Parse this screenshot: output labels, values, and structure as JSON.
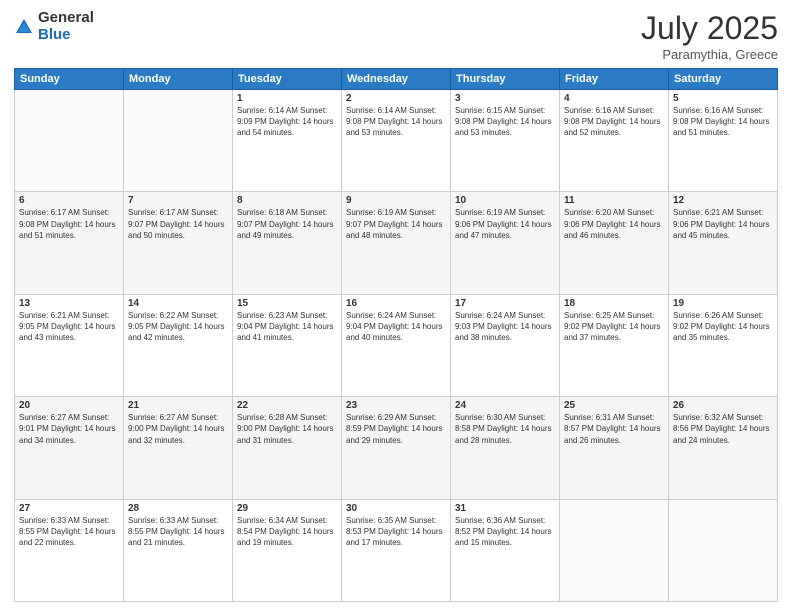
{
  "header": {
    "logo_general": "General",
    "logo_blue": "Blue",
    "title": "July 2025",
    "location": "Paramythia, Greece"
  },
  "weekdays": [
    "Sunday",
    "Monday",
    "Tuesday",
    "Wednesday",
    "Thursday",
    "Friday",
    "Saturday"
  ],
  "weeks": [
    [
      {
        "day": "",
        "info": ""
      },
      {
        "day": "",
        "info": ""
      },
      {
        "day": "1",
        "info": "Sunrise: 6:14 AM\nSunset: 9:09 PM\nDaylight: 14 hours and 54 minutes."
      },
      {
        "day": "2",
        "info": "Sunrise: 6:14 AM\nSunset: 9:08 PM\nDaylight: 14 hours and 53 minutes."
      },
      {
        "day": "3",
        "info": "Sunrise: 6:15 AM\nSunset: 9:08 PM\nDaylight: 14 hours and 53 minutes."
      },
      {
        "day": "4",
        "info": "Sunrise: 6:16 AM\nSunset: 9:08 PM\nDaylight: 14 hours and 52 minutes."
      },
      {
        "day": "5",
        "info": "Sunrise: 6:16 AM\nSunset: 9:08 PM\nDaylight: 14 hours and 51 minutes."
      }
    ],
    [
      {
        "day": "6",
        "info": "Sunrise: 6:17 AM\nSunset: 9:08 PM\nDaylight: 14 hours and 51 minutes."
      },
      {
        "day": "7",
        "info": "Sunrise: 6:17 AM\nSunset: 9:07 PM\nDaylight: 14 hours and 50 minutes."
      },
      {
        "day": "8",
        "info": "Sunrise: 6:18 AM\nSunset: 9:07 PM\nDaylight: 14 hours and 49 minutes."
      },
      {
        "day": "9",
        "info": "Sunrise: 6:19 AM\nSunset: 9:07 PM\nDaylight: 14 hours and 48 minutes."
      },
      {
        "day": "10",
        "info": "Sunrise: 6:19 AM\nSunset: 9:06 PM\nDaylight: 14 hours and 47 minutes."
      },
      {
        "day": "11",
        "info": "Sunrise: 6:20 AM\nSunset: 9:06 PM\nDaylight: 14 hours and 46 minutes."
      },
      {
        "day": "12",
        "info": "Sunrise: 6:21 AM\nSunset: 9:06 PM\nDaylight: 14 hours and 45 minutes."
      }
    ],
    [
      {
        "day": "13",
        "info": "Sunrise: 6:21 AM\nSunset: 9:05 PM\nDaylight: 14 hours and 43 minutes."
      },
      {
        "day": "14",
        "info": "Sunrise: 6:22 AM\nSunset: 9:05 PM\nDaylight: 14 hours and 42 minutes."
      },
      {
        "day": "15",
        "info": "Sunrise: 6:23 AM\nSunset: 9:04 PM\nDaylight: 14 hours and 41 minutes."
      },
      {
        "day": "16",
        "info": "Sunrise: 6:24 AM\nSunset: 9:04 PM\nDaylight: 14 hours and 40 minutes."
      },
      {
        "day": "17",
        "info": "Sunrise: 6:24 AM\nSunset: 9:03 PM\nDaylight: 14 hours and 38 minutes."
      },
      {
        "day": "18",
        "info": "Sunrise: 6:25 AM\nSunset: 9:02 PM\nDaylight: 14 hours and 37 minutes."
      },
      {
        "day": "19",
        "info": "Sunrise: 6:26 AM\nSunset: 9:02 PM\nDaylight: 14 hours and 35 minutes."
      }
    ],
    [
      {
        "day": "20",
        "info": "Sunrise: 6:27 AM\nSunset: 9:01 PM\nDaylight: 14 hours and 34 minutes."
      },
      {
        "day": "21",
        "info": "Sunrise: 6:27 AM\nSunset: 9:00 PM\nDaylight: 14 hours and 32 minutes."
      },
      {
        "day": "22",
        "info": "Sunrise: 6:28 AM\nSunset: 9:00 PM\nDaylight: 14 hours and 31 minutes."
      },
      {
        "day": "23",
        "info": "Sunrise: 6:29 AM\nSunset: 8:59 PM\nDaylight: 14 hours and 29 minutes."
      },
      {
        "day": "24",
        "info": "Sunrise: 6:30 AM\nSunset: 8:58 PM\nDaylight: 14 hours and 28 minutes."
      },
      {
        "day": "25",
        "info": "Sunrise: 6:31 AM\nSunset: 8:57 PM\nDaylight: 14 hours and 26 minutes."
      },
      {
        "day": "26",
        "info": "Sunrise: 6:32 AM\nSunset: 8:56 PM\nDaylight: 14 hours and 24 minutes."
      }
    ],
    [
      {
        "day": "27",
        "info": "Sunrise: 6:33 AM\nSunset: 8:55 PM\nDaylight: 14 hours and 22 minutes."
      },
      {
        "day": "28",
        "info": "Sunrise: 6:33 AM\nSunset: 8:55 PM\nDaylight: 14 hours and 21 minutes."
      },
      {
        "day": "29",
        "info": "Sunrise: 6:34 AM\nSunset: 8:54 PM\nDaylight: 14 hours and 19 minutes."
      },
      {
        "day": "30",
        "info": "Sunrise: 6:35 AM\nSunset: 8:53 PM\nDaylight: 14 hours and 17 minutes."
      },
      {
        "day": "31",
        "info": "Sunrise: 6:36 AM\nSunset: 8:52 PM\nDaylight: 14 hours and 15 minutes."
      },
      {
        "day": "",
        "info": ""
      },
      {
        "day": "",
        "info": ""
      }
    ]
  ]
}
